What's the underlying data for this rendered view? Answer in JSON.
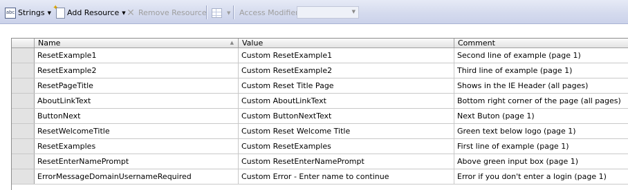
{
  "toolbar": {
    "strings_label": "Strings",
    "strings_icon": "abc-icon",
    "add_resource_label": "Add Resource",
    "add_resource_icon": "new-page-icon",
    "remove_resource_label": "Remove Resource",
    "remove_resource_icon": "delete-x-icon",
    "view_icon": "grid-view-icon",
    "access_modifier_label": "Access Modifier:",
    "access_modifier_value": ""
  },
  "grid": {
    "columns": [
      "Name",
      "Value",
      "Comment"
    ],
    "rows": [
      {
        "name": "ResetExample1",
        "value": "Custom ResetExample1",
        "comment": "Second line of example (page 1)"
      },
      {
        "name": "ResetExample2",
        "value": "Custom ResetExample2",
        "comment": "Third line of example (page 1)"
      },
      {
        "name": "ResetPageTitle",
        "value": "Custom Reset Title Page",
        "comment": "Shows in the IE Header (all pages)"
      },
      {
        "name": "AboutLinkText",
        "value": "Custom AboutLinkText",
        "comment": "Bottom right corner of the page (all pages)"
      },
      {
        "name": "ButtonNext",
        "value": "Custom ButtonNextText",
        "comment": "Next Buton (page 1)"
      },
      {
        "name": "ResetWelcomeTitle",
        "value": "Custom Reset Welcome Title",
        "comment": "Green text below logo  (page 1)"
      },
      {
        "name": "ResetExamples",
        "value": "Custom ResetExamples",
        "comment": "First line of example  (page 1)"
      },
      {
        "name": "ResetEnterNamePrompt",
        "value": "Custom ResetEnterNamePrompt",
        "comment": "Above green input box  (page 1)"
      },
      {
        "name": "ErrorMessageDomainUsernameRequired",
        "value": "Custom Error - Enter name to continue",
        "comment": "Error if you don't enter a login (page 1)"
      }
    ]
  }
}
